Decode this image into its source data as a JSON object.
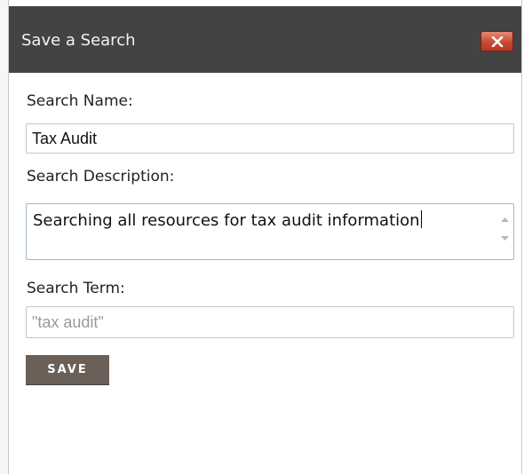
{
  "dialog": {
    "title": "Save a Search",
    "close_icon": "close-x-icon"
  },
  "form": {
    "name_label": "Search Name:",
    "name_value": "Tax Audit",
    "description_label": "Search Description:",
    "description_value": "Searching all resources for tax audit information",
    "term_label": "Search Term:",
    "term_placeholder": "\"tax audit\"",
    "save_label": "SAVE"
  },
  "colors": {
    "titlebar": "#434343",
    "close_button": "#c84a33",
    "save_button": "#6b6058"
  }
}
